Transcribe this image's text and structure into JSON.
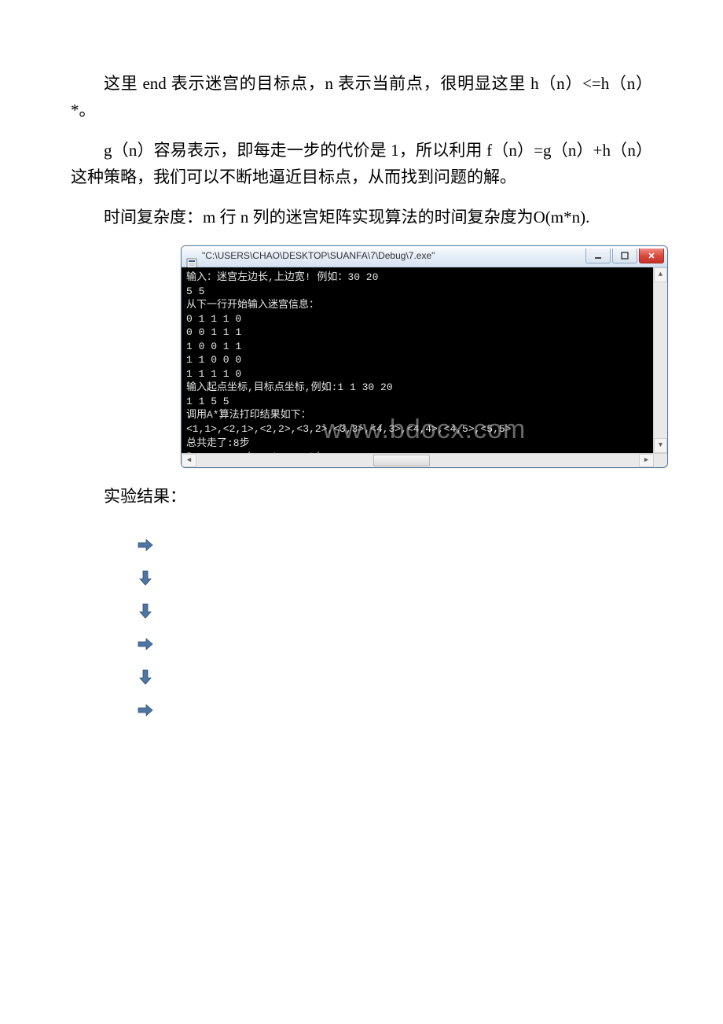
{
  "paragraphs": {
    "p1": "这里 end 表示迷宫的目标点，n 表示当前点，很明显这里 h（n）<=h（n）*。",
    "p2": "g（n）容易表示，即每走一步的代价是 1，所以利用 f（n）=g（n）+h（n）这种策略，我们可以不断地逼近目标点，从而找到问题的解。",
    "p3": "时间复杂度：m 行 n 列的迷宫矩阵实现算法的时间复杂度为O(m*n).",
    "result_label": "实验结果："
  },
  "console": {
    "title": "\"C:\\USERS\\CHAO\\DESKTOP\\SUANFA\\7\\Debug\\7.exe\"",
    "lines": [
      "输入：迷宫左边长,上边宽! 例如：30 20",
      "5 5",
      "从下一行开始输入迷宫信息：",
      "0 1 1 1 0",
      "0 0 1 1 1",
      "1 0 0 1 1",
      "1 1 0 0 0",
      "1 1 1 1 0",
      "输入起点坐标,目标点坐标,例如:1 1 30 20",
      "1 1 5 5",
      "调用A*算法打印结果如下：",
      "<1,1>,<2,1>,<2,2>,<3,2>,<3,3>,<4,3>,<4,4>,<4,5>,<5,5>",
      "总共走了:8步",
      "Press any key to continue"
    ],
    "watermark": "www.bdocx.com"
  },
  "arrows": [
    "right",
    "down",
    "down",
    "right",
    "down",
    "right"
  ],
  "colors": {
    "arrow_fill": "#4f76a3",
    "arrow_stroke": "#2d4f73"
  }
}
